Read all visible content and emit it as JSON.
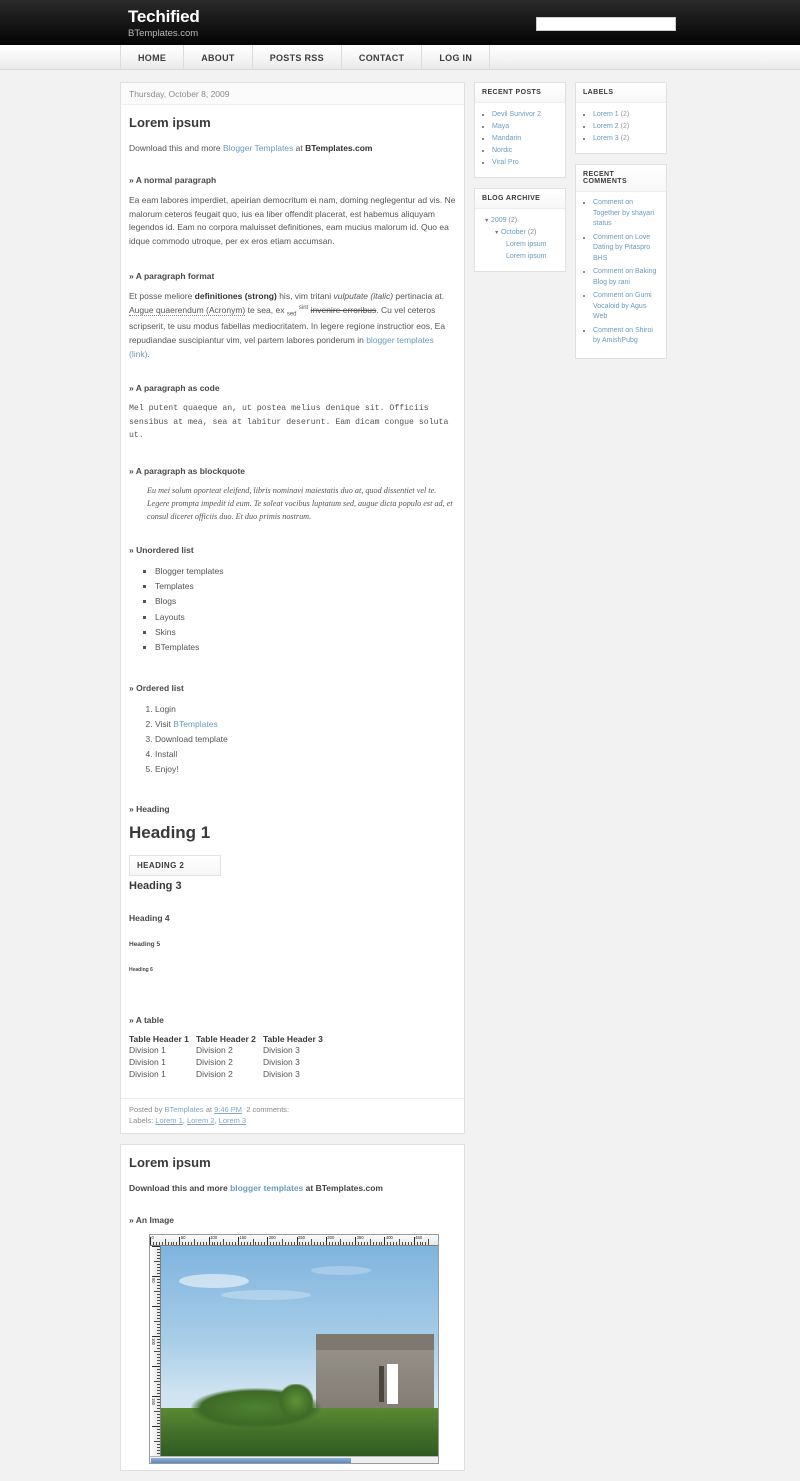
{
  "header": {
    "title": "Techified",
    "subtitle": "BTemplates.com",
    "search_value": "",
    "search_placeholder": ""
  },
  "nav": {
    "items": [
      {
        "label": "HOME",
        "name": "nav-home"
      },
      {
        "label": "ABOUT",
        "name": "nav-about"
      },
      {
        "label": "POSTS RSS",
        "name": "nav-posts-rss"
      },
      {
        "label": "CONTACT",
        "name": "nav-contact"
      },
      {
        "label": "LOG IN",
        "name": "nav-log-in"
      }
    ]
  },
  "post1": {
    "date": "Thursday, October 8, 2009",
    "title": "Lorem ipsum",
    "intro_pre": "Download this and more ",
    "intro_link": "Blogger Templates",
    "intro_mid": " at ",
    "intro_strong": "BTemplates.com",
    "sec_normal_head": "» A normal paragraph",
    "sec_normal_text": "Ea eam labores imperdiet, apeirian democritum ei nam, doming neglegentur ad vis. Ne malorum ceteros feugait quo, ius ea liber offendit placerat, est habemus aliquyam legendos id. Eam no corpora maluisset definitiones, eam mucius malorum id. Quo ea idque commodo utroque, per ex eros etiam accumsan.",
    "sec_format_head": "» A paragraph format",
    "fmt_1": "Et posse meliore ",
    "fmt_strong": "definitiones (strong)",
    "fmt_2": " his, vim tritani ",
    "fmt_italic": "vulputate (italic)",
    "fmt_3": " pertinacia at. ",
    "fmt_acronym": "Augue quaerendum (Acronym)",
    "fmt_4": " te sea, ex ",
    "fmt_sub": "sed",
    "fmt_5": " ",
    "fmt_sup": "sint",
    "fmt_6": " ",
    "fmt_strike": "invenire erroribus",
    "fmt_7": ". Cu vel ceteros scripserit, te usu modus fabellas mediocritatem. In legere regione instructior eos, Ea repudiandae suscipiantur vim, vel partem labores ponderum in ",
    "fmt_link": "blogger templates (link)",
    "fmt_8": ".",
    "sec_code_head": "» A paragraph as code",
    "code_text": "Mel putent quaeque an, ut postea melius denique sit. Officiis\nsensibus at mea, sea at labitur deserunt. Eam dicam congue soluta\nut.",
    "sec_bq_head": "» A paragraph as blockquote",
    "bq_text": "Eu mei solum oporteat eleifend, libris nominavi maiestatis duo at, quod dissentiet vel te. Legere prompta impedit id eum. Te soleat vocibus luptatum sed, augue dicta populo est ad, et consul diceret officiis duo. Et duo primis nostrum.",
    "sec_ul_head": "» Unordered list",
    "ul_items": [
      "Blogger templates",
      "Templates",
      "Blogs",
      "Layouts",
      "Skins",
      "BTemplates"
    ],
    "sec_ol_head": "» Ordered list",
    "ol_items": [
      "Login",
      "Visit BTemplates",
      "Download template",
      "Install",
      "Enjoy!"
    ],
    "ol_item2_pre": "Visit ",
    "ol_item2_link": "BTemplates",
    "sec_heading_head": "» Heading",
    "h1": "Heading 1",
    "h2": "HEADING 2",
    "h3": "Heading 3",
    "h4": "Heading 4",
    "h5": "Heading 5",
    "h6": "Heading 6",
    "sec_table_head": "» A table",
    "table": {
      "headers": [
        "Table Header 1",
        "Table Header 2",
        "Table Header 3"
      ],
      "rows": [
        [
          "Division 1",
          "Division 2",
          "Division 3"
        ],
        [
          "Division 1",
          "Division 2",
          "Division 3"
        ],
        [
          "Division 1",
          "Division 2",
          "Division 3"
        ]
      ]
    },
    "footer": {
      "posted_by_pre": "Posted by ",
      "author": "BTemplates",
      "at": " at ",
      "time": "9:46 PM",
      "comments": "2 comments:",
      "labels_label": "Labels: ",
      "labels": [
        "Lorem 1",
        "Lorem 2",
        "Lorem 3"
      ]
    }
  },
  "post2": {
    "title": "Lorem ipsum",
    "intro_pre": "Download this and more ",
    "intro_link": "blogger templates",
    "intro_mid": " at ",
    "intro_strong": "BTemplates.com",
    "sec_image_head": "» An Image",
    "ruler_labels": [
      "0",
      "50",
      "100",
      "150",
      "200",
      "250",
      "300",
      "350",
      "400",
      "450"
    ],
    "ruler_v_labels": [
      "50",
      "100",
      "150"
    ]
  },
  "sidebar1": {
    "recent_posts": {
      "title": "RECENT POSTS",
      "items": [
        "Devil Survivor 2",
        "Maya",
        "Mandarin",
        "Nordic",
        "Viral Pro"
      ]
    },
    "blog_archive": {
      "title": "BLOG ARCHIVE",
      "year": "2009",
      "year_count": "(2)",
      "month": "October",
      "month_count": "(2)",
      "posts": [
        "Lorem ipsum",
        "Lorem ipsum"
      ],
      "triangle": "▼"
    }
  },
  "sidebar2": {
    "labels": {
      "title": "LABELS",
      "items": [
        {
          "label": "Lorem 1",
          "count": "(2)"
        },
        {
          "label": "Lorem 2",
          "count": "(2)"
        },
        {
          "label": "Lorem 3",
          "count": "(2)"
        }
      ]
    },
    "recent_comments": {
      "title": "RECENT COMMENTS",
      "items": [
        "Comment on Together by shayari status",
        "Comment on Love Dating by Pitaspro BHS",
        "Comment on Baking Blog by rani",
        "Comment on Gumi Vocaloid by Agus Web",
        "Comment on Shiroi by AmishPubg"
      ]
    }
  }
}
